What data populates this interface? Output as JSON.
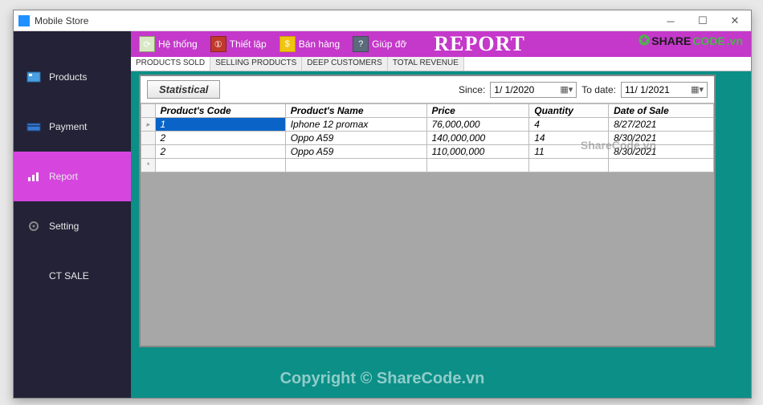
{
  "window": {
    "title": "Mobile Store"
  },
  "ribbon": {
    "items": [
      {
        "label": "Hệ thống"
      },
      {
        "label": "Thiết lập"
      },
      {
        "label": "Bán hàng"
      },
      {
        "label": "Giúp đỡ"
      }
    ],
    "big_title": "REPORT"
  },
  "sidebar": {
    "items": [
      {
        "label": "Products"
      },
      {
        "label": "Payment"
      },
      {
        "label": "Report"
      },
      {
        "label": "Setting"
      },
      {
        "label": "CT SALE"
      }
    ]
  },
  "tabs": [
    {
      "label": "PRODUCTS SOLD"
    },
    {
      "label": "SELLING PRODUCTS"
    },
    {
      "label": "DEEP CUSTOMERS"
    },
    {
      "label": "TOTAL REVENUE"
    }
  ],
  "panel": {
    "stat_button": "Statistical",
    "since_label": "Since:",
    "since_value": "1/ 1/2020",
    "todate_label": "To date:",
    "todate_value": "11/ 1/2021"
  },
  "grid": {
    "columns": [
      "Product's Code",
      "Product's Name",
      "Price",
      "Quantity",
      "Date of Sale"
    ],
    "rows": [
      {
        "code": "1",
        "name": "Iphone 12 promax",
        "price": "76,000,000",
        "qty": "4",
        "date": "8/27/2021"
      },
      {
        "code": "2",
        "name": "Oppo A59",
        "price": "140,000,000",
        "qty": "14",
        "date": "8/30/2021"
      },
      {
        "code": "2",
        "name": "Oppo A59",
        "price": "110,000,000",
        "qty": "11",
        "date": "8/30/2021"
      }
    ]
  },
  "watermark": {
    "main": "Copyright © ShareCode.vn",
    "side": "ShareCode.vn",
    "logo_a": "SHARE",
    "logo_b": "CODE",
    "logo_c": ".vn"
  }
}
